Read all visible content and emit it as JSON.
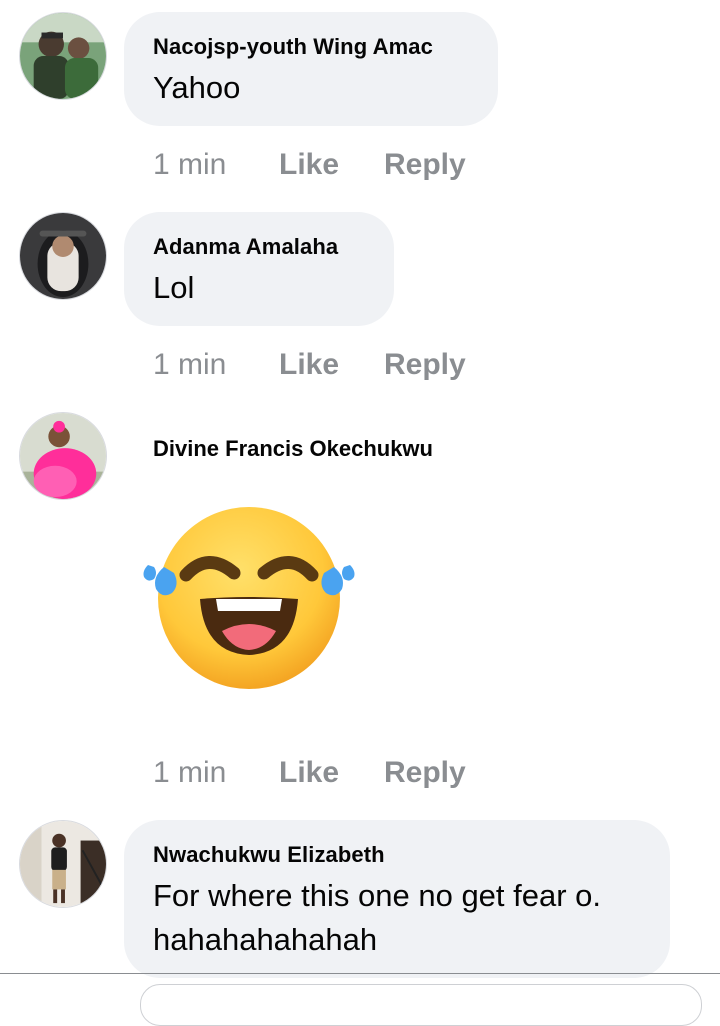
{
  "comments": [
    {
      "author": "Nacojsp-youth Wing Amac",
      "text": "Yahoo",
      "time": "1 min",
      "like": "Like",
      "reply": "Reply"
    },
    {
      "author": "Adanma Amalaha",
      "text": "Lol",
      "time": "1 min",
      "like": "Like",
      "reply": "Reply"
    },
    {
      "author": "Divine Francis Okechukwu",
      "sticker": "laughing-tears-emoji",
      "time": "1 min",
      "like": "Like",
      "reply": "Reply"
    },
    {
      "author": "Nwachukwu Elizabeth",
      "text_lines": [
        "For where this one no get fear o.",
        "hahahahahahah"
      ]
    }
  ],
  "colors": {
    "bubble": "#f0f2f5",
    "meta_text": "#8a8d91",
    "name_text": "#050505",
    "emoji_face": "#ffc83a",
    "emoji_tears": "#4aa3f0"
  }
}
